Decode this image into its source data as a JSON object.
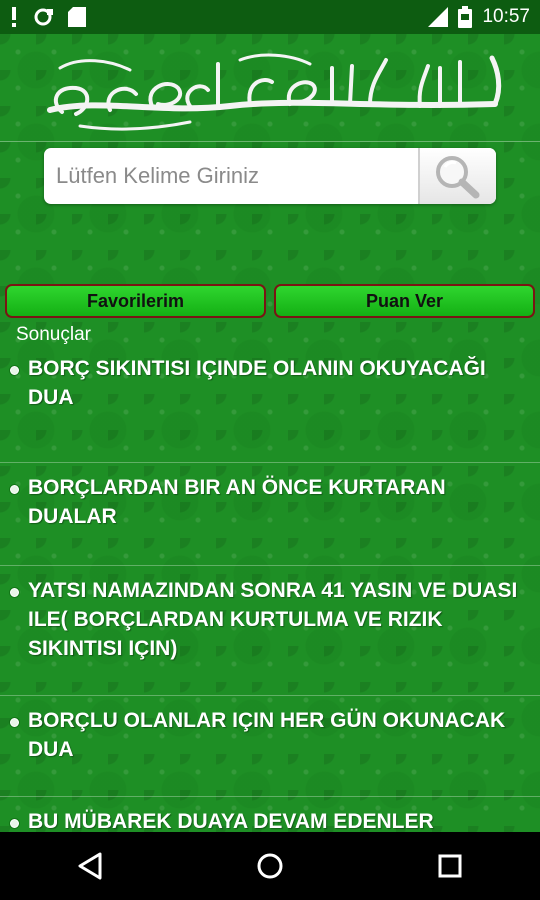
{
  "status_bar": {
    "time": "10:57",
    "icons_left": [
      "alert-icon",
      "sync-icon",
      "sd-card-icon"
    ],
    "icons_right": [
      "signal-icon",
      "battery-icon"
    ]
  },
  "header": {
    "logo": "bismillah-calligraphy"
  },
  "search": {
    "placeholder": "Lütfen Kelime Giriniz",
    "value": "",
    "button_icon": "search-icon"
  },
  "buttons": {
    "favorites_label": "Favorilerim",
    "rate_label": "Puan Ver"
  },
  "results": {
    "label": "Sonuçlar",
    "items": [
      {
        "title": "BORÇ SIKINTISI IÇINDE OLANIN OKUYACAĞI DUA"
      },
      {
        "title": "BORÇLARDAN BIR AN ÖNCE KURTARAN DUALAR"
      },
      {
        "title": "YATSI NAMAZINDAN SONRA 41 YASIN VE DUASI ILE( BORÇLARDAN KURTULMA VE RIZIK SIKINTISI IÇIN)"
      },
      {
        "title": "BORÇLU OLANLAR IÇIN HER GÜN OKUNACAK DUA"
      },
      {
        "title": "BU MÜBAREK DUAYA DEVAM EDENLER"
      }
    ]
  },
  "nav": {
    "back": "back-icon",
    "home": "home-icon",
    "recents": "recents-icon"
  },
  "colors": {
    "status_bar": "#0d5c11",
    "background": "#1e8f25",
    "button_green": "#22c422",
    "button_border": "#7a1414",
    "text": "#ffffff"
  }
}
